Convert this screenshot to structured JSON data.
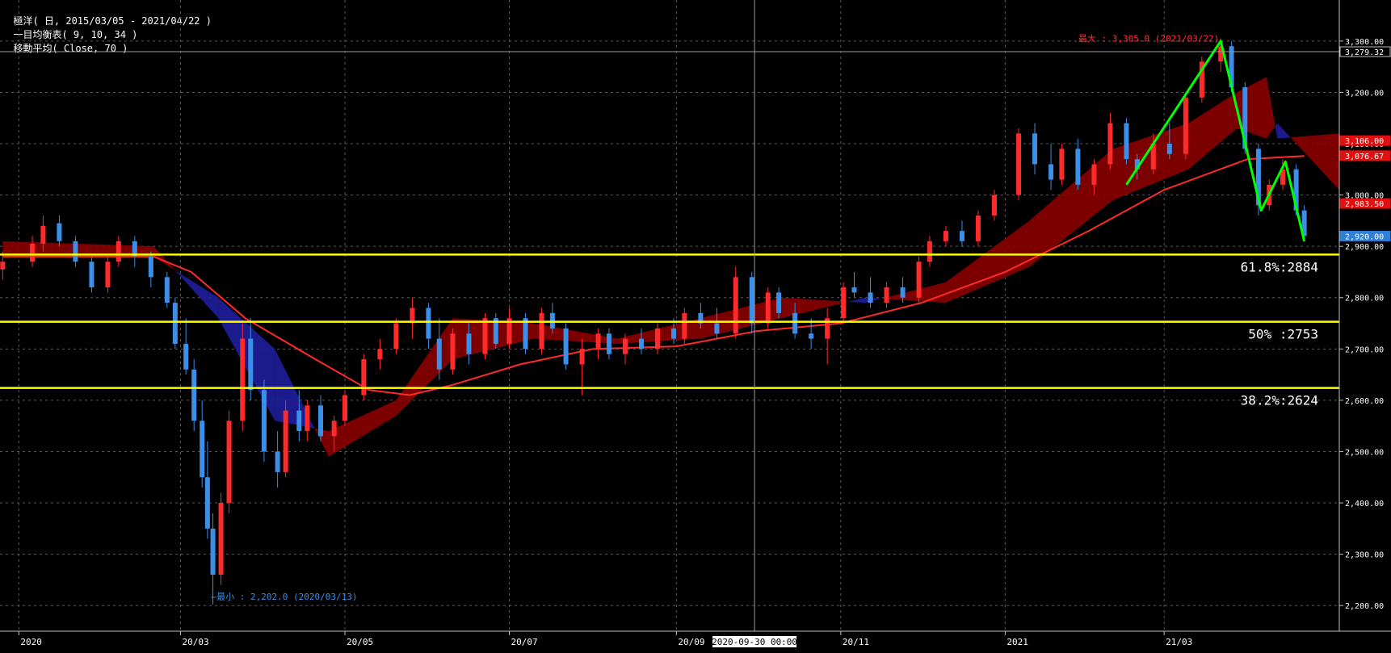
{
  "header": {
    "period_label": "極洋( 日, 2015/03/05 - 2021/04/22 )",
    "ichimoku_label": "一目均衡表( 9, 10, 34 )",
    "ma_label": "移動平均( Close, 70 )"
  },
  "colors": {
    "background": "#000000",
    "grid": "#5a5a5a",
    "candle_up": "#ff2a2a",
    "candle_down": "#3b8fe6",
    "ma": "#ff2a2a",
    "cloud_bull": "#8b0000",
    "cloud_bear": "#1e1e9c",
    "fib_line": "#ffff00",
    "zigzag": "#00ff00",
    "max_label": "#ff3030",
    "min_label": "#3b8fe6"
  },
  "chart_data": {
    "type": "candlestick",
    "ylim": [
      2150,
      3380
    ],
    "y_ticks": [
      {
        "value": 3300,
        "label": "3,300.00"
      },
      {
        "value": 3200,
        "label": "3,200.00"
      },
      {
        "value": 3100,
        "label": "3,100.00"
      },
      {
        "value": 3000,
        "label": "3,000.00"
      },
      {
        "value": 2900,
        "label": "2,900.00"
      },
      {
        "value": 2800,
        "label": "2,800.00"
      },
      {
        "value": 2700,
        "label": "2,700.00"
      },
      {
        "value": 2600,
        "label": "2,600.00"
      },
      {
        "value": 2500,
        "label": "2,500.00"
      },
      {
        "value": 2400,
        "label": "2,400.00"
      },
      {
        "value": 2300,
        "label": "2,300.00"
      },
      {
        "value": 2200,
        "label": "2,200.00"
      }
    ],
    "x_ticks": [
      {
        "date": "2020-01-01",
        "label": "2020"
      },
      {
        "date": "2020-03-01",
        "label": "20/03"
      },
      {
        "date": "2020-05-01",
        "label": "20/05"
      },
      {
        "date": "2020-07-01",
        "label": "20/07"
      },
      {
        "date": "2020-09-01",
        "label": "20/09"
      },
      {
        "date": "2020-11-01",
        "label": "20/11"
      },
      {
        "date": "2021-01-01",
        "label": "2021"
      },
      {
        "date": "2021-03-01",
        "label": "21/03"
      }
    ],
    "x_range": [
      "2019-12-25",
      "2021-05-05"
    ],
    "crosshair": {
      "date": "2020-09-30",
      "price": 3279.32,
      "date_label": "2020-09-30  00:00",
      "price_label": "3,279.32"
    },
    "price_tags": [
      {
        "value": 3279.32,
        "label": "3,279.32",
        "style": "crosshair"
      },
      {
        "value": 3106,
        "label": "3,106.00",
        "style": "red"
      },
      {
        "value": 3076.67,
        "label": "3,076.67",
        "style": "red"
      },
      {
        "value": 2983.5,
        "label": "2,983.50",
        "style": "red"
      },
      {
        "value": 2920,
        "label": "2,920.00",
        "style": "blue"
      }
    ],
    "max_annotation": {
      "date": "2021-03-22",
      "value": 3305,
      "text": "最大 : 3,305.0 (2021/03/22)"
    },
    "min_annotation": {
      "date": "2020-03-13",
      "value": 2202,
      "text": "←最小 : 2,202.0 (2020/03/13)"
    },
    "fibonacci": [
      {
        "value": 2884,
        "label": "61.8%:2884"
      },
      {
        "value": 2753,
        "label": "50% :2753"
      },
      {
        "value": 2624,
        "label": "38.2%:2624"
      }
    ],
    "zigzag": [
      {
        "date": "2021-02-15",
        "value": 3020
      },
      {
        "date": "2021-03-22",
        "value": 3300
      },
      {
        "date": "2021-04-06",
        "value": 2970
      },
      {
        "date": "2021-04-15",
        "value": 3065
      },
      {
        "date": "2021-04-22",
        "value": 2910
      }
    ],
    "candles": [
      [
        "2019-12-26",
        2855,
        2890,
        2835,
        2870
      ],
      [
        "2020-01-06",
        2870,
        2920,
        2860,
        2905
      ],
      [
        "2020-01-10",
        2905,
        2960,
        2890,
        2940
      ],
      [
        "2020-01-16",
        2945,
        2960,
        2900,
        2910
      ],
      [
        "2020-01-22",
        2910,
        2920,
        2860,
        2870
      ],
      [
        "2020-01-28",
        2870,
        2880,
        2810,
        2820
      ],
      [
        "2020-02-03",
        2820,
        2880,
        2810,
        2870
      ],
      [
        "2020-02-07",
        2870,
        2920,
        2860,
        2910
      ],
      [
        "2020-02-13",
        2910,
        2920,
        2860,
        2880
      ],
      [
        "2020-02-19",
        2880,
        2890,
        2820,
        2840
      ],
      [
        "2020-02-25",
        2840,
        2850,
        2780,
        2790
      ],
      [
        "2020-02-28",
        2790,
        2800,
        2700,
        2710
      ],
      [
        "2020-03-03",
        2710,
        2760,
        2650,
        2660
      ],
      [
        "2020-03-06",
        2660,
        2680,
        2540,
        2560
      ],
      [
        "2020-03-09",
        2560,
        2600,
        2430,
        2450
      ],
      [
        "2020-03-11",
        2450,
        2520,
        2330,
        2350
      ],
      [
        "2020-03-13",
        2350,
        2380,
        2202,
        2260
      ],
      [
        "2020-03-16",
        2260,
        2420,
        2240,
        2400
      ],
      [
        "2020-03-19",
        2400,
        2580,
        2380,
        2560
      ],
      [
        "2020-03-24",
        2560,
        2750,
        2540,
        2720
      ],
      [
        "2020-03-27",
        2720,
        2760,
        2600,
        2620
      ],
      [
        "2020-04-01",
        2620,
        2640,
        2480,
        2500
      ],
      [
        "2020-04-06",
        2500,
        2540,
        2430,
        2460
      ],
      [
        "2020-04-09",
        2460,
        2600,
        2450,
        2580
      ],
      [
        "2020-04-14",
        2580,
        2620,
        2520,
        2540
      ],
      [
        "2020-04-17",
        2540,
        2600,
        2520,
        2590
      ],
      [
        "2020-04-22",
        2590,
        2610,
        2520,
        2530
      ],
      [
        "2020-04-27",
        2530,
        2570,
        2500,
        2560
      ],
      [
        "2020-05-01",
        2560,
        2620,
        2550,
        2610
      ],
      [
        "2020-05-08",
        2610,
        2690,
        2600,
        2680
      ],
      [
        "2020-05-14",
        2680,
        2720,
        2660,
        2700
      ],
      [
        "2020-05-20",
        2700,
        2760,
        2690,
        2750
      ],
      [
        "2020-05-26",
        2750,
        2800,
        2720,
        2780
      ],
      [
        "2020-06-01",
        2780,
        2790,
        2700,
        2720
      ],
      [
        "2020-06-05",
        2720,
        2760,
        2640,
        2660
      ],
      [
        "2020-06-10",
        2660,
        2740,
        2650,
        2730
      ],
      [
        "2020-06-16",
        2730,
        2750,
        2670,
        2690
      ],
      [
        "2020-06-22",
        2690,
        2770,
        2680,
        2760
      ],
      [
        "2020-06-26",
        2760,
        2770,
        2700,
        2710
      ],
      [
        "2020-07-01",
        2710,
        2780,
        2700,
        2760
      ],
      [
        "2020-07-07",
        2760,
        2770,
        2690,
        2700
      ],
      [
        "2020-07-13",
        2700,
        2780,
        2690,
        2770
      ],
      [
        "2020-07-17",
        2770,
        2790,
        2730,
        2740
      ],
      [
        "2020-07-22",
        2740,
        2750,
        2660,
        2670
      ],
      [
        "2020-07-28",
        2670,
        2720,
        2610,
        2700
      ],
      [
        "2020-08-03",
        2700,
        2740,
        2680,
        2730
      ],
      [
        "2020-08-07",
        2730,
        2740,
        2680,
        2690
      ],
      [
        "2020-08-13",
        2690,
        2730,
        2670,
        2720
      ],
      [
        "2020-08-19",
        2720,
        2740,
        2690,
        2700
      ],
      [
        "2020-08-25",
        2700,
        2750,
        2690,
        2740
      ],
      [
        "2020-08-31",
        2740,
        2760,
        2710,
        2720
      ],
      [
        "2020-09-04",
        2720,
        2780,
        2710,
        2770
      ],
      [
        "2020-09-10",
        2770,
        2790,
        2740,
        2750
      ],
      [
        "2020-09-16",
        2750,
        2780,
        2720,
        2730
      ],
      [
        "2020-09-23",
        2730,
        2860,
        2720,
        2840
      ],
      [
        "2020-09-29",
        2840,
        2850,
        2730,
        2750
      ],
      [
        "2020-10-05",
        2750,
        2820,
        2740,
        2810
      ],
      [
        "2020-10-09",
        2810,
        2820,
        2760,
        2770
      ],
      [
        "2020-10-15",
        2770,
        2790,
        2720,
        2730
      ],
      [
        "2020-10-21",
        2730,
        2760,
        2700,
        2720
      ],
      [
        "2020-10-27",
        2720,
        2780,
        2670,
        2760
      ],
      [
        "2020-11-02",
        2760,
        2830,
        2750,
        2820
      ],
      [
        "2020-11-06",
        2820,
        2850,
        2800,
        2810
      ],
      [
        "2020-11-12",
        2810,
        2840,
        2780,
        2790
      ],
      [
        "2020-11-18",
        2790,
        2830,
        2780,
        2820
      ],
      [
        "2020-11-24",
        2820,
        2840,
        2790,
        2800
      ],
      [
        "2020-11-30",
        2800,
        2880,
        2790,
        2870
      ],
      [
        "2020-12-04",
        2870,
        2920,
        2860,
        2910
      ],
      [
        "2020-12-10",
        2910,
        2940,
        2900,
        2930
      ],
      [
        "2020-12-16",
        2930,
        2950,
        2900,
        2910
      ],
      [
        "2020-12-22",
        2910,
        2970,
        2900,
        2960
      ],
      [
        "2020-12-28",
        2960,
        3010,
        2950,
        3000
      ],
      [
        "2021-01-06",
        3000,
        3130,
        2990,
        3120
      ],
      [
        "2021-01-12",
        3120,
        3140,
        3040,
        3060
      ],
      [
        "2021-01-18",
        3060,
        3100,
        3010,
        3030
      ],
      [
        "2021-01-22",
        3030,
        3100,
        3020,
        3090
      ],
      [
        "2021-01-28",
        3090,
        3110,
        3010,
        3020
      ],
      [
        "2021-02-03",
        3020,
        3070,
        3000,
        3060
      ],
      [
        "2021-02-09",
        3060,
        3160,
        3050,
        3140
      ],
      [
        "2021-02-15",
        3140,
        3150,
        3060,
        3070
      ],
      [
        "2021-02-19",
        3070,
        3080,
        3030,
        3050
      ],
      [
        "2021-02-25",
        3050,
        3120,
        3040,
        3100
      ],
      [
        "2021-03-03",
        3100,
        3140,
        3070,
        3080
      ],
      [
        "2021-03-09",
        3080,
        3200,
        3070,
        3190
      ],
      [
        "2021-03-15",
        3190,
        3270,
        3180,
        3260
      ],
      [
        "2021-03-22",
        3260,
        3305,
        3240,
        3290
      ],
      [
        "2021-03-26",
        3290,
        3300,
        3200,
        3210
      ],
      [
        "2021-03-31",
        3210,
        3220,
        3080,
        3090
      ],
      [
        "2021-04-05",
        3090,
        3100,
        2960,
        2980
      ],
      [
        "2021-04-09",
        2980,
        3030,
        2970,
        3020
      ],
      [
        "2021-04-14",
        3020,
        3070,
        3010,
        3050
      ],
      [
        "2021-04-19",
        3050,
        3060,
        2960,
        2970
      ],
      [
        "2021-04-22",
        2970,
        2980,
        2910,
        2920
      ]
    ],
    "ma70": [
      [
        "2019-12-26",
        2880
      ],
      [
        "2020-02-20",
        2880
      ],
      [
        "2020-03-05",
        2850
      ],
      [
        "2020-03-25",
        2760
      ],
      [
        "2020-04-20",
        2680
      ],
      [
        "2020-05-10",
        2620
      ],
      [
        "2020-05-25",
        2610
      ],
      [
        "2020-06-10",
        2630
      ],
      [
        "2020-07-05",
        2670
      ],
      [
        "2020-08-01",
        2700
      ],
      [
        "2020-09-01",
        2705
      ],
      [
        "2020-10-01",
        2735
      ],
      [
        "2020-11-01",
        2750
      ],
      [
        "2020-12-01",
        2790
      ],
      [
        "2021-01-01",
        2850
      ],
      [
        "2021-02-01",
        2930
      ],
      [
        "2021-03-01",
        3010
      ],
      [
        "2021-04-01",
        3070
      ],
      [
        "2021-04-22",
        3076
      ]
    ],
    "cloud": {
      "span_a": [
        [
          "2019-12-26",
          2910
        ],
        [
          "2020-02-20",
          2900
        ],
        [
          "2020-03-15",
          2760
        ],
        [
          "2020-04-05",
          2560
        ],
        [
          "2020-04-25",
          2540
        ],
        [
          "2020-05-20",
          2600
        ],
        [
          "2020-06-10",
          2760
        ],
        [
          "2020-07-10",
          2750
        ],
        [
          "2020-08-10",
          2720
        ],
        [
          "2020-09-10",
          2760
        ],
        [
          "2020-10-10",
          2800
        ],
        [
          "2020-11-10",
          2790
        ],
        [
          "2020-12-10",
          2830
        ],
        [
          "2021-01-10",
          2950
        ],
        [
          "2021-02-10",
          3090
        ],
        [
          "2021-03-10",
          3140
        ],
        [
          "2021-03-28",
          3200
        ],
        [
          "2021-04-08",
          3230
        ],
        [
          "2021-04-12",
          3110
        ],
        [
          "2021-05-05",
          3120
        ]
      ],
      "span_b": [
        [
          "2019-12-26",
          2880
        ],
        [
          "2020-02-20",
          2880
        ],
        [
          "2020-03-15",
          2800
        ],
        [
          "2020-04-05",
          2700
        ],
        [
          "2020-04-25",
          2490
        ],
        [
          "2020-05-20",
          2570
        ],
        [
          "2020-06-10",
          2680
        ],
        [
          "2020-07-10",
          2720
        ],
        [
          "2020-08-10",
          2710
        ],
        [
          "2020-09-10",
          2720
        ],
        [
          "2020-10-10",
          2760
        ],
        [
          "2020-11-10",
          2800
        ],
        [
          "2020-12-10",
          2790
        ],
        [
          "2021-01-10",
          2860
        ],
        [
          "2021-02-10",
          2990
        ],
        [
          "2021-03-10",
          3050
        ],
        [
          "2021-03-28",
          3130
        ],
        [
          "2021-04-08",
          3110
        ],
        [
          "2021-04-12",
          3140
        ],
        [
          "2021-05-05",
          3010
        ]
      ]
    }
  }
}
